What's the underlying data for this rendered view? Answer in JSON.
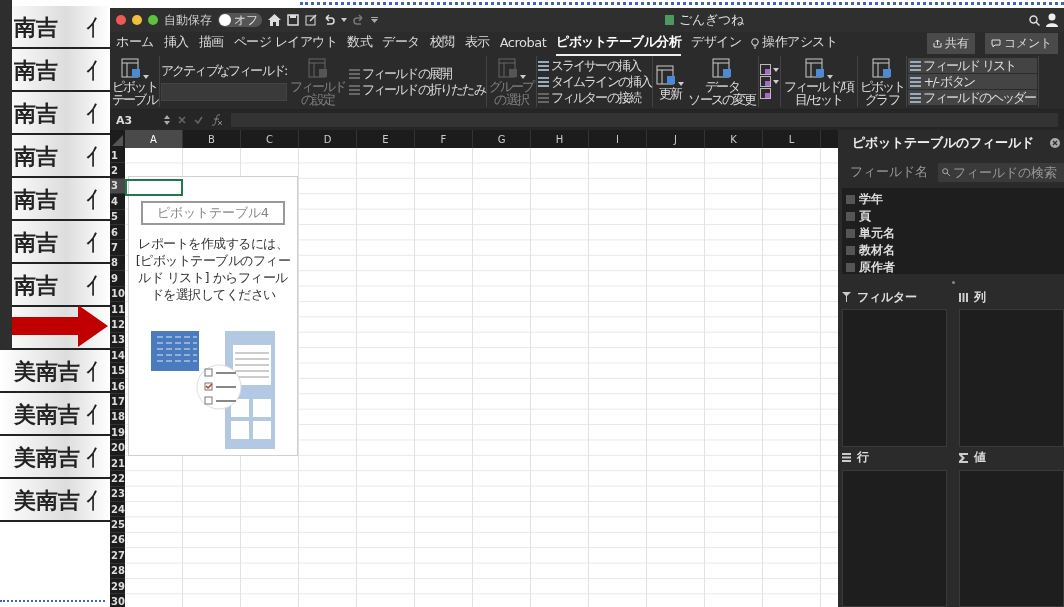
{
  "background_list": {
    "rows": [
      {
        "name": "南吉",
        "next": "亻"
      },
      {
        "name": "南吉",
        "next": "亻"
      },
      {
        "name": "南吉",
        "next": "亻"
      },
      {
        "name": "南吉",
        "next": "亻"
      },
      {
        "name": "南吉",
        "next": "亻"
      },
      {
        "name": "南吉",
        "next": "亻"
      },
      {
        "name": "南吉",
        "next": "亻"
      },
      {},
      {
        "name": "美南吉",
        "next": "亻"
      },
      {
        "name": "美南吉",
        "next": "亻"
      },
      {
        "name": "美南吉",
        "next": "亻"
      },
      {
        "name": "美南吉",
        "next": "亻"
      }
    ]
  },
  "window": {
    "title": "ごんぎつね",
    "autosave": {
      "label": "自動保存",
      "state": "オフ",
      "on": false
    }
  },
  "ribbon_tabs": [
    {
      "label": "ホーム",
      "selected": false
    },
    {
      "label": "挿入",
      "selected": false
    },
    {
      "label": "描画",
      "selected": false
    },
    {
      "label": "ページ レイアウト",
      "selected": false
    },
    {
      "label": "数式",
      "selected": false
    },
    {
      "label": "データ",
      "selected": false
    },
    {
      "label": "校閲",
      "selected": false
    },
    {
      "label": "表示",
      "selected": false
    },
    {
      "label": "Acrobat",
      "selected": false
    },
    {
      "label": "ピボットテーブル分析",
      "selected": true
    },
    {
      "label": "デザイン",
      "selected": false
    }
  ],
  "assist": "操作アシスト",
  "share_button": "共有",
  "comment_button": "コメント",
  "ribbon_groups": [
    {
      "items": [
        {
          "kind": "big",
          "lines": [
            "ピボット",
            "テーブル"
          ],
          "disabled": false,
          "dropdown": true
        }
      ]
    },
    {
      "items": [
        {
          "kind": "field",
          "label": "アクティブなフィールド:"
        },
        {
          "kind": "big",
          "lines": [
            "フィールド",
            "の設定"
          ],
          "disabled": true,
          "dropdown": false
        },
        {
          "kind": "stack",
          "children": [
            {
              "kind": "small",
              "label": "フィールドの展開",
              "disabled": true
            },
            {
              "kind": "small",
              "label": "フィールドの折りたたみ",
              "disabled": true
            }
          ]
        }
      ]
    },
    {
      "items": [
        {
          "kind": "big",
          "lines": [
            "グループ",
            "の選択"
          ],
          "disabled": true,
          "dropdown": true
        }
      ]
    },
    {
      "items": [
        {
          "kind": "stack",
          "children": [
            {
              "kind": "small",
              "label": "スライサーの挿入",
              "disabled": false
            },
            {
              "kind": "small",
              "label": "タイムラインの挿入",
              "disabled": false
            },
            {
              "kind": "small",
              "label": "フィルターの接続",
              "disabled": true
            }
          ]
        }
      ]
    },
    {
      "items": [
        {
          "kind": "big",
          "lines": [
            "更新"
          ],
          "disabled": false,
          "dropdown": true
        },
        {
          "kind": "big",
          "lines": [
            "データ",
            "ソースの変更"
          ],
          "disabled": false,
          "dropdown": false
        }
      ]
    },
    {
      "items": [
        {
          "kind": "stack",
          "children": [
            {
              "kind": "icon",
              "dropdown": true
            },
            {
              "kind": "icon",
              "dropdown": true
            },
            {
              "kind": "icon",
              "dropdown": false
            }
          ]
        }
      ]
    },
    {
      "items": [
        {
          "kind": "big",
          "lines": [
            "フィールド/項目/セット"
          ],
          "disabled": false,
          "dropdown": true
        }
      ]
    },
    {
      "items": [
        {
          "kind": "big",
          "lines": [
            "ピボット",
            "グラフ"
          ],
          "disabled": false,
          "dropdown": false
        }
      ]
    },
    {
      "items": [
        {
          "kind": "stack",
          "children": [
            {
              "kind": "toggle",
              "label": "フィールド リスト",
              "on": true
            },
            {
              "kind": "toggle",
              "label": "+/- ボタン",
              "on": true
            },
            {
              "kind": "toggle",
              "label": "フィールドのヘッダー",
              "on": true
            }
          ]
        }
      ]
    }
  ],
  "formula_bar": {
    "name_box": "A3"
  },
  "sheet": {
    "columns": [
      {
        "label": "A",
        "selected": true
      },
      {
        "label": "B",
        "selected": false
      },
      {
        "label": "C",
        "selected": false
      },
      {
        "label": "D",
        "selected": false
      },
      {
        "label": "E",
        "selected": false
      },
      {
        "label": "F",
        "selected": false
      },
      {
        "label": "G",
        "selected": false
      },
      {
        "label": "H",
        "selected": false
      },
      {
        "label": "I",
        "selected": false
      },
      {
        "label": "J",
        "selected": false
      },
      {
        "label": "K",
        "selected": false
      },
      {
        "label": "L",
        "selected": false
      }
    ],
    "rows": [
      {
        "label": "1",
        "selected": false
      },
      {
        "label": "2",
        "selected": false
      },
      {
        "label": "3",
        "selected": true
      },
      {
        "label": "4",
        "selected": false
      },
      {
        "label": "5",
        "selected": false
      },
      {
        "label": "6",
        "selected": false
      },
      {
        "label": "7",
        "selected": false
      },
      {
        "label": "8",
        "selected": false
      },
      {
        "label": "9",
        "selected": false
      },
      {
        "label": "10",
        "selected": false
      },
      {
        "label": "11",
        "selected": false
      },
      {
        "label": "12",
        "selected": false
      },
      {
        "label": "13",
        "selected": false
      },
      {
        "label": "14",
        "selected": false
      },
      {
        "label": "15",
        "selected": false
      },
      {
        "label": "16",
        "selected": false
      },
      {
        "label": "17",
        "selected": false
      },
      {
        "label": "18",
        "selected": false
      },
      {
        "label": "19",
        "selected": false
      },
      {
        "label": "20",
        "selected": false
      },
      {
        "label": "21",
        "selected": false
      },
      {
        "label": "22",
        "selected": false
      },
      {
        "label": "23",
        "selected": false
      },
      {
        "label": "24",
        "selected": false
      },
      {
        "label": "25",
        "selected": false
      },
      {
        "label": "26",
        "selected": false
      },
      {
        "label": "27",
        "selected": false
      },
      {
        "label": "28",
        "selected": false
      },
      {
        "label": "29",
        "selected": false
      },
      {
        "label": "30",
        "selected": false
      }
    ],
    "pivot_placeholder": {
      "name": "ピボットテーブル4",
      "instruction": "レポートを作成するには、[ピボットテーブルのフィールド リスト] からフィールドを選択してください"
    }
  },
  "field_panel": {
    "title": "ピボットテーブルのフィールド",
    "field_name_label": "フィールド名",
    "search": {
      "placeholder": "フィールドの検索"
    },
    "fields": [
      {
        "label": "学年",
        "checked": false
      },
      {
        "label": "頁",
        "checked": false
      },
      {
        "label": "単元名",
        "checked": false
      },
      {
        "label": "教材名",
        "checked": false
      },
      {
        "label": "原作者",
        "checked": false
      }
    ],
    "areas": [
      {
        "kind": "filter",
        "label": "フィルター"
      },
      {
        "kind": "columns",
        "label": "列"
      },
      {
        "kind": "rows",
        "label": "行"
      },
      {
        "kind": "values",
        "label": "値"
      }
    ]
  }
}
